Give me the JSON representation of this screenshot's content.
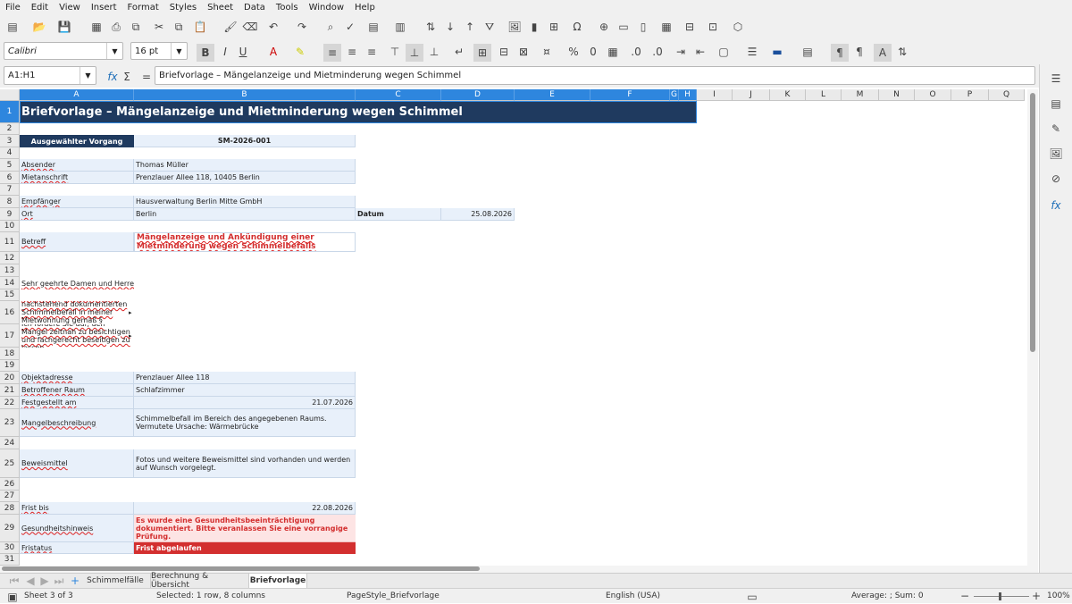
{
  "menu": [
    "File",
    "Edit",
    "View",
    "Insert",
    "Format",
    "Styles",
    "Sheet",
    "Data",
    "Tools",
    "Window",
    "Help"
  ],
  "font_name": "Calibri",
  "font_size": "16 pt",
  "name_box": "A1:H1",
  "formula": "Briefvorlage – Mängelanzeige und Mietminderung wegen Schimmel",
  "columns": [
    {
      "id": "A",
      "w": 128,
      "on": true
    },
    {
      "id": "B",
      "w": 248,
      "on": true
    },
    {
      "id": "C",
      "w": 96,
      "on": true
    },
    {
      "id": "D",
      "w": 82,
      "on": true
    },
    {
      "id": "E",
      "w": 85,
      "on": true
    },
    {
      "id": "F",
      "w": 89,
      "on": true
    },
    {
      "id": "G",
      "w": 10,
      "on": true
    },
    {
      "id": "H",
      "w": 20,
      "on": true
    },
    {
      "id": "I",
      "w": 40
    },
    {
      "id": "J",
      "w": 42
    },
    {
      "id": "K",
      "w": 40
    },
    {
      "id": "L",
      "w": 40
    },
    {
      "id": "M",
      "w": 42
    },
    {
      "id": "N",
      "w": 40
    },
    {
      "id": "O",
      "w": 41
    },
    {
      "id": "P",
      "w": 42
    },
    {
      "id": "Q",
      "w": 40
    }
  ],
  "rows": [
    {
      "n": "1",
      "h": 25
    },
    {
      "n": "2",
      "h": 13
    },
    {
      "n": "3",
      "h": 14
    },
    {
      "n": "4",
      "h": 13
    },
    {
      "n": "5",
      "h": 14
    },
    {
      "n": "6",
      "h": 14
    },
    {
      "n": "7",
      "h": 13
    },
    {
      "n": "8",
      "h": 14
    },
    {
      "n": "9",
      "h": 14
    },
    {
      "n": "10",
      "h": 13
    },
    {
      "n": "11",
      "h": 22
    },
    {
      "n": "12",
      "h": 14
    },
    {
      "n": "13",
      "h": 14
    },
    {
      "n": "14",
      "h": 14
    },
    {
      "n": "15",
      "h": 13
    },
    {
      "n": "16",
      "h": 26
    },
    {
      "n": "17",
      "h": 26
    },
    {
      "n": "18",
      "h": 14
    },
    {
      "n": "19",
      "h": 13
    },
    {
      "n": "20",
      "h": 14
    },
    {
      "n": "21",
      "h": 14
    },
    {
      "n": "22",
      "h": 14
    },
    {
      "n": "23",
      "h": 31
    },
    {
      "n": "24",
      "h": 14
    },
    {
      "n": "25",
      "h": 32
    },
    {
      "n": "26",
      "h": 14
    },
    {
      "n": "27",
      "h": 13
    },
    {
      "n": "28",
      "h": 14
    },
    {
      "n": "29",
      "h": 31
    },
    {
      "n": "30",
      "h": 13
    },
    {
      "n": "31",
      "h": 13
    }
  ],
  "sheet": {
    "title": "Briefvorlage – Mängelanzeige und Mietminderung wegen Schimmel",
    "vorgang_label": "Ausgewählter Vorgang",
    "vorgang_value": "SM-2026-001",
    "absender_label": "Absender",
    "absender_value": "Thomas Müller",
    "mietanschrift_label": "Mietanschrift",
    "mietanschrift_value": "Prenzlauer Allee 118, 10405 Berlin",
    "empfaenger_label": "Empfänger",
    "empfaenger_value": "Hausverwaltung Berlin Mitte GmbH",
    "ort_label": "Ort",
    "ort_value": "Berlin",
    "datum_label": "Datum",
    "datum_value": "25.08.2026",
    "betreff_label": "Betreff",
    "betreff_value": "Mängelanzeige und Ankündigung einer Mietminderung wegen Schimmelbefalls",
    "anrede": "Sehr geehrte Damen und Herren,",
    "text16": "hiermit zeige ich Ihnen den nachstehend dokumentierten Schimmelbefall in meiner Mietwohnung gemäß §",
    "text17": "Ich fordere Sie auf, den Mangel zeitnah zu besichtigen und fachgerecht beseitigen zu lassen.",
    "objekt_label": "Objektadresse",
    "objekt_value": "Prenzlauer Allee 118",
    "raum_label": "Betroffener Raum",
    "raum_value": "Schlafzimmer",
    "festgestellt_label": "Festgestellt am",
    "festgestellt_value": "21.07.2026",
    "mangel_label": "Mangelbeschreibung",
    "mangel_value": "Schimmelbefall im Bereich des angegebenen Raums. Vermutete Ursache: Wärmebrücke",
    "beweis_label": "Beweismittel",
    "beweis_value": "Fotos und weitere Beweismittel sind vorhanden und werden auf Wunsch vorgelegt.",
    "frist_label": "Frist bis",
    "frist_value": "22.08.2026",
    "gesundheit_label": "Gesundheitshinweis",
    "gesundheit_value": "Es wurde eine Gesundheitsbeeinträchtigung dokumentiert. Bitte veranlassen Sie eine vorrangige Prüfung.",
    "fristst_label": "Fristatus",
    "fristst_value": "Frist abgelaufen"
  },
  "tabs": [
    "Schimmelfälle",
    "Berechnung & Übersicht",
    "Briefvorlage"
  ],
  "status": {
    "sheet": "Sheet 3 of 3",
    "selection": "Selected: 1 row, 8 columns",
    "pagestyle": "PageStyle_Briefvorlage",
    "language": "English (USA)",
    "sum": "Average: ; Sum: 0",
    "zoom": "100%"
  },
  "colors": {
    "header": "#1f3a5f",
    "accent": "#2e86de",
    "red": "#d32f2f",
    "labelbg": "#e8f0fa",
    "warnbg": "#fde4e4"
  }
}
